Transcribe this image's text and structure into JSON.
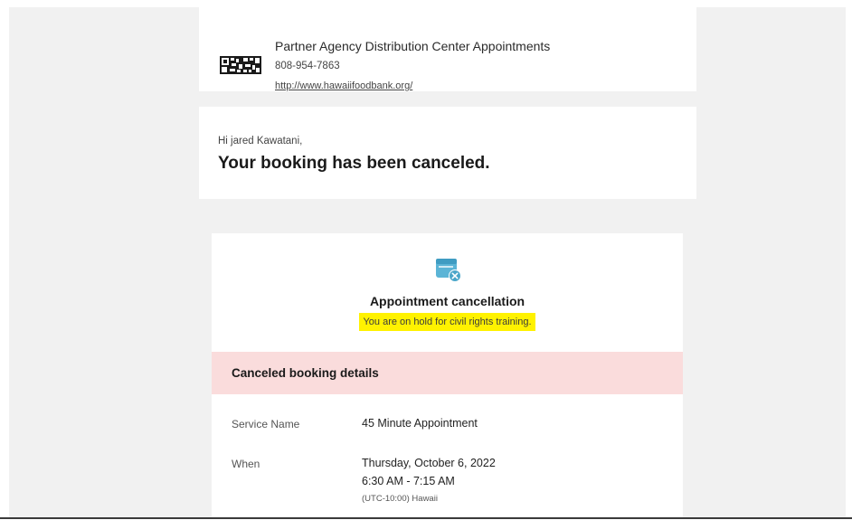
{
  "header": {
    "org_name": "Partner Agency Distribution Center Appointments",
    "phone": "808-954-7863",
    "website": "http://www.hawaiifoodbank.org/",
    "logo_icon": "qr-code-logo-icon"
  },
  "greeting": {
    "salutation": "Hi jared Kawatani,",
    "headline": "Your booking has been canceled."
  },
  "cancellation": {
    "icon": "calendar-cancel-icon",
    "title": "Appointment cancellation",
    "note": "You are on hold for civil rights training.",
    "highlight_color": "#fff200"
  },
  "details": {
    "banner": "Canceled booking details",
    "banner_color": "#fadcdc",
    "rows": [
      {
        "label": "Service Name",
        "value": "45 Minute Appointment"
      },
      {
        "label": "When",
        "value": "Thursday, October 6, 2022",
        "value2": "6:30 AM - 7:15 AM",
        "sub": "(UTC-10:00) Hawaii"
      }
    ]
  },
  "accent_color": "#4aa6c9"
}
